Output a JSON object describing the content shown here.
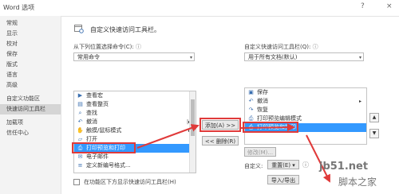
{
  "window": {
    "title": "Word 选项",
    "help": "?",
    "close": "×"
  },
  "sidebar": {
    "items": [
      {
        "label": "常规"
      },
      {
        "label": "显示"
      },
      {
        "label": "校对"
      },
      {
        "label": "保存"
      },
      {
        "label": "版式"
      },
      {
        "label": "语言"
      },
      {
        "label": "高级"
      },
      {
        "label": "自定义功能区"
      },
      {
        "label": "快速访问工具栏"
      },
      {
        "label": "加载项"
      },
      {
        "label": "信任中心"
      }
    ],
    "selected": "快速访问工具栏"
  },
  "header": {
    "title": "自定义快速访问工具栏。"
  },
  "left": {
    "choose_label": "从下列位置选择命令(C):",
    "info_icon": "ⓘ",
    "choose_value": "常用命令",
    "list_items": [
      {
        "label": "查看宏",
        "icon": "macro-icon"
      },
      {
        "label": "查看整页",
        "icon": "fullpage-icon"
      },
      {
        "label": "查找",
        "icon": "find-icon"
      },
      {
        "label": "撤消",
        "icon": "undo-icon",
        "sub": "|▸"
      },
      {
        "label": "触摸/鼠标模式",
        "icon": "touch-icon",
        "sub": "▸"
      },
      {
        "label": "打开",
        "icon": "open-icon"
      },
      {
        "label": "打印预览和打印",
        "icon": "print-preview-icon"
      },
      {
        "label": "电子邮件",
        "icon": "email-icon"
      },
      {
        "label": "定义新编号格式...",
        "icon": "numbering-icon"
      }
    ],
    "selected_item": "打印预览和打印",
    "show_below_label": "在功能区下方显示快速访问工具栏(H)"
  },
  "middle": {
    "add_label": "添加(A) >>",
    "remove_label": "<< 删除(R)"
  },
  "right": {
    "customize_label": "自定义快速访问工具栏(Q):",
    "info_icon": "ⓘ",
    "scope_value": "用于所有文档(默认)",
    "list_items": [
      {
        "label": "保存",
        "icon": "save-icon"
      },
      {
        "label": "撤消",
        "icon": "undo-icon",
        "sub": "▸"
      },
      {
        "label": "恢复",
        "icon": "redo-icon"
      },
      {
        "label": "打印预览编辑模式",
        "icon": "print-edit-icon"
      },
      {
        "label": "打印预览和打印",
        "icon": "print-preview-icon"
      }
    ],
    "selected_item": "打印预览和打印",
    "modify_label": "修改(M)...",
    "customize_prefix": "自定义:",
    "reset_label": "重置(E) ▾",
    "import_export_label": "导入/导出"
  },
  "move_buttons": {
    "up": "▲",
    "down": "▼"
  },
  "watermark": {
    "domain": "jb51.net",
    "brand": "脚本之家"
  },
  "colors": {
    "selection": "#3399ff",
    "annotation": "#e03a3a",
    "sidebar_bg": "#f3f3f3",
    "sidebar_selected": "#d5d5d5"
  }
}
